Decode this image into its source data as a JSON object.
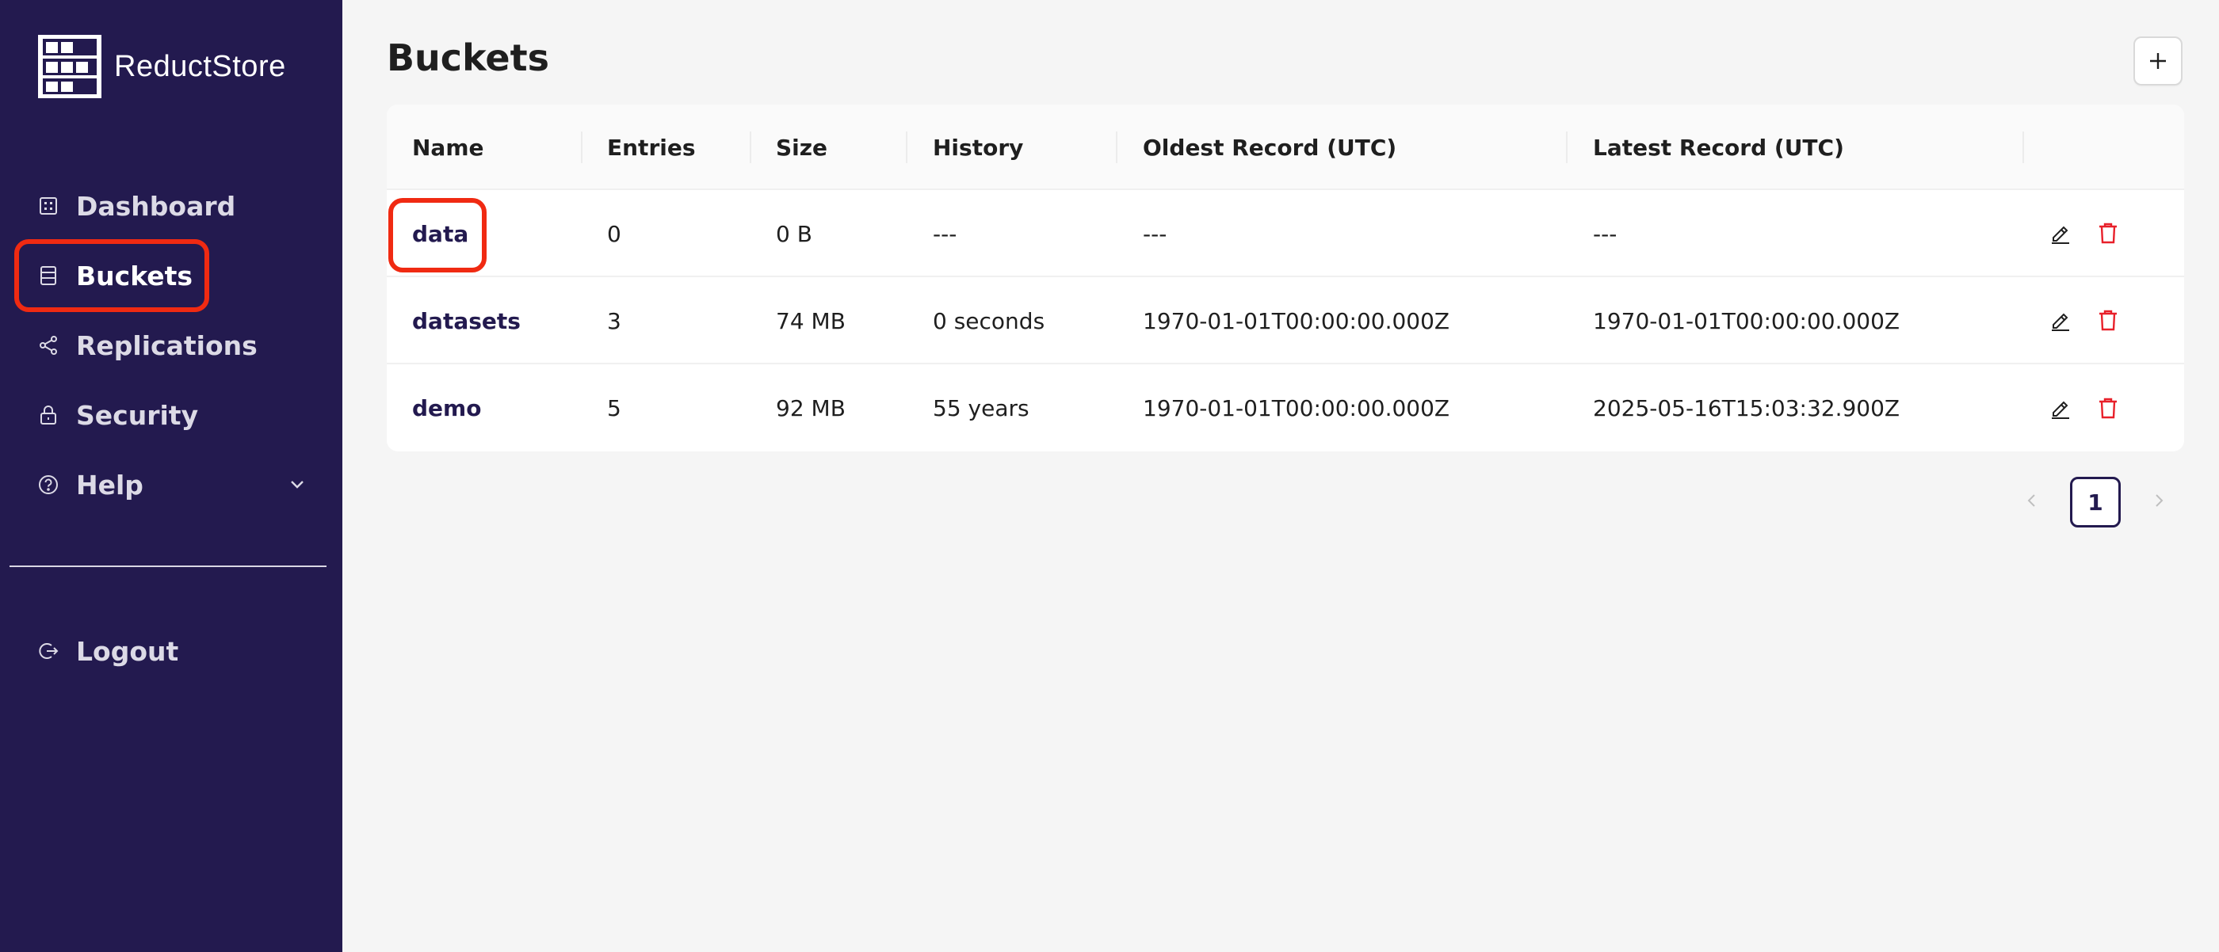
{
  "app": {
    "name": "ReductStore",
    "logo_icon": "shelves-logo-icon"
  },
  "colors": {
    "sidebar_bg": "#231a4f",
    "accent": "#231a4f",
    "highlight": "#f02a12",
    "delete": "#e8202a"
  },
  "sidebar": {
    "items": [
      {
        "label": "Dashboard",
        "icon": "dashboard-icon"
      },
      {
        "label": "Buckets",
        "icon": "bucket-icon",
        "active": true
      },
      {
        "label": "Replications",
        "icon": "share-icon"
      },
      {
        "label": "Security",
        "icon": "lock-icon"
      },
      {
        "label": "Help",
        "icon": "help-circle-icon",
        "expandable": true
      }
    ],
    "logout_label": "Logout"
  },
  "main": {
    "title": "Buckets",
    "add_button_icon": "plus-icon",
    "table": {
      "columns": [
        "Name",
        "Entries",
        "Size",
        "History",
        "Oldest Record (UTC)",
        "Latest Record (UTC)"
      ],
      "rows": [
        {
          "name": "data",
          "entries": "0",
          "size": "0 B",
          "history": "---",
          "oldest": "---",
          "latest": "---"
        },
        {
          "name": "datasets",
          "entries": "3",
          "size": "74 MB",
          "history": "0 seconds",
          "oldest": "1970-01-01T00:00:00.000Z",
          "latest": "1970-01-01T00:00:00.000Z"
        },
        {
          "name": "demo",
          "entries": "5",
          "size": "92 MB",
          "history": "55 years",
          "oldest": "1970-01-01T00:00:00.000Z",
          "latest": "2025-05-16T15:03:32.900Z"
        }
      ],
      "row_actions": [
        "edit-icon",
        "delete-icon"
      ]
    },
    "pagination": {
      "current_page": "1"
    }
  }
}
